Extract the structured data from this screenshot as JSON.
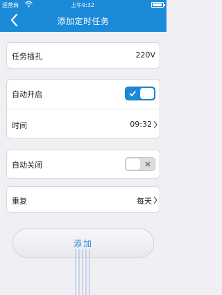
{
  "status_bar": {
    "carrier": "运营商",
    "time": "上午9:32",
    "wifi_icon": "wifi-icon",
    "battery_icon": "battery-icon"
  },
  "nav": {
    "title": "添加定时任务",
    "back_icon": "back-chevron-icon"
  },
  "socket": {
    "label": "任务插孔",
    "value": "220V"
  },
  "auto_on": {
    "label": "自动开启",
    "enabled": true,
    "time_label": "时间",
    "time_value": "09:32"
  },
  "auto_off": {
    "label": "自动关闭",
    "enabled": false
  },
  "repeat": {
    "label": "重复",
    "value": "每天"
  },
  "add_button": {
    "label": "添加"
  },
  "colors": {
    "accent": "#1b8ad8",
    "background": "#efeff4",
    "toggle_off": "#dcdcdc"
  }
}
